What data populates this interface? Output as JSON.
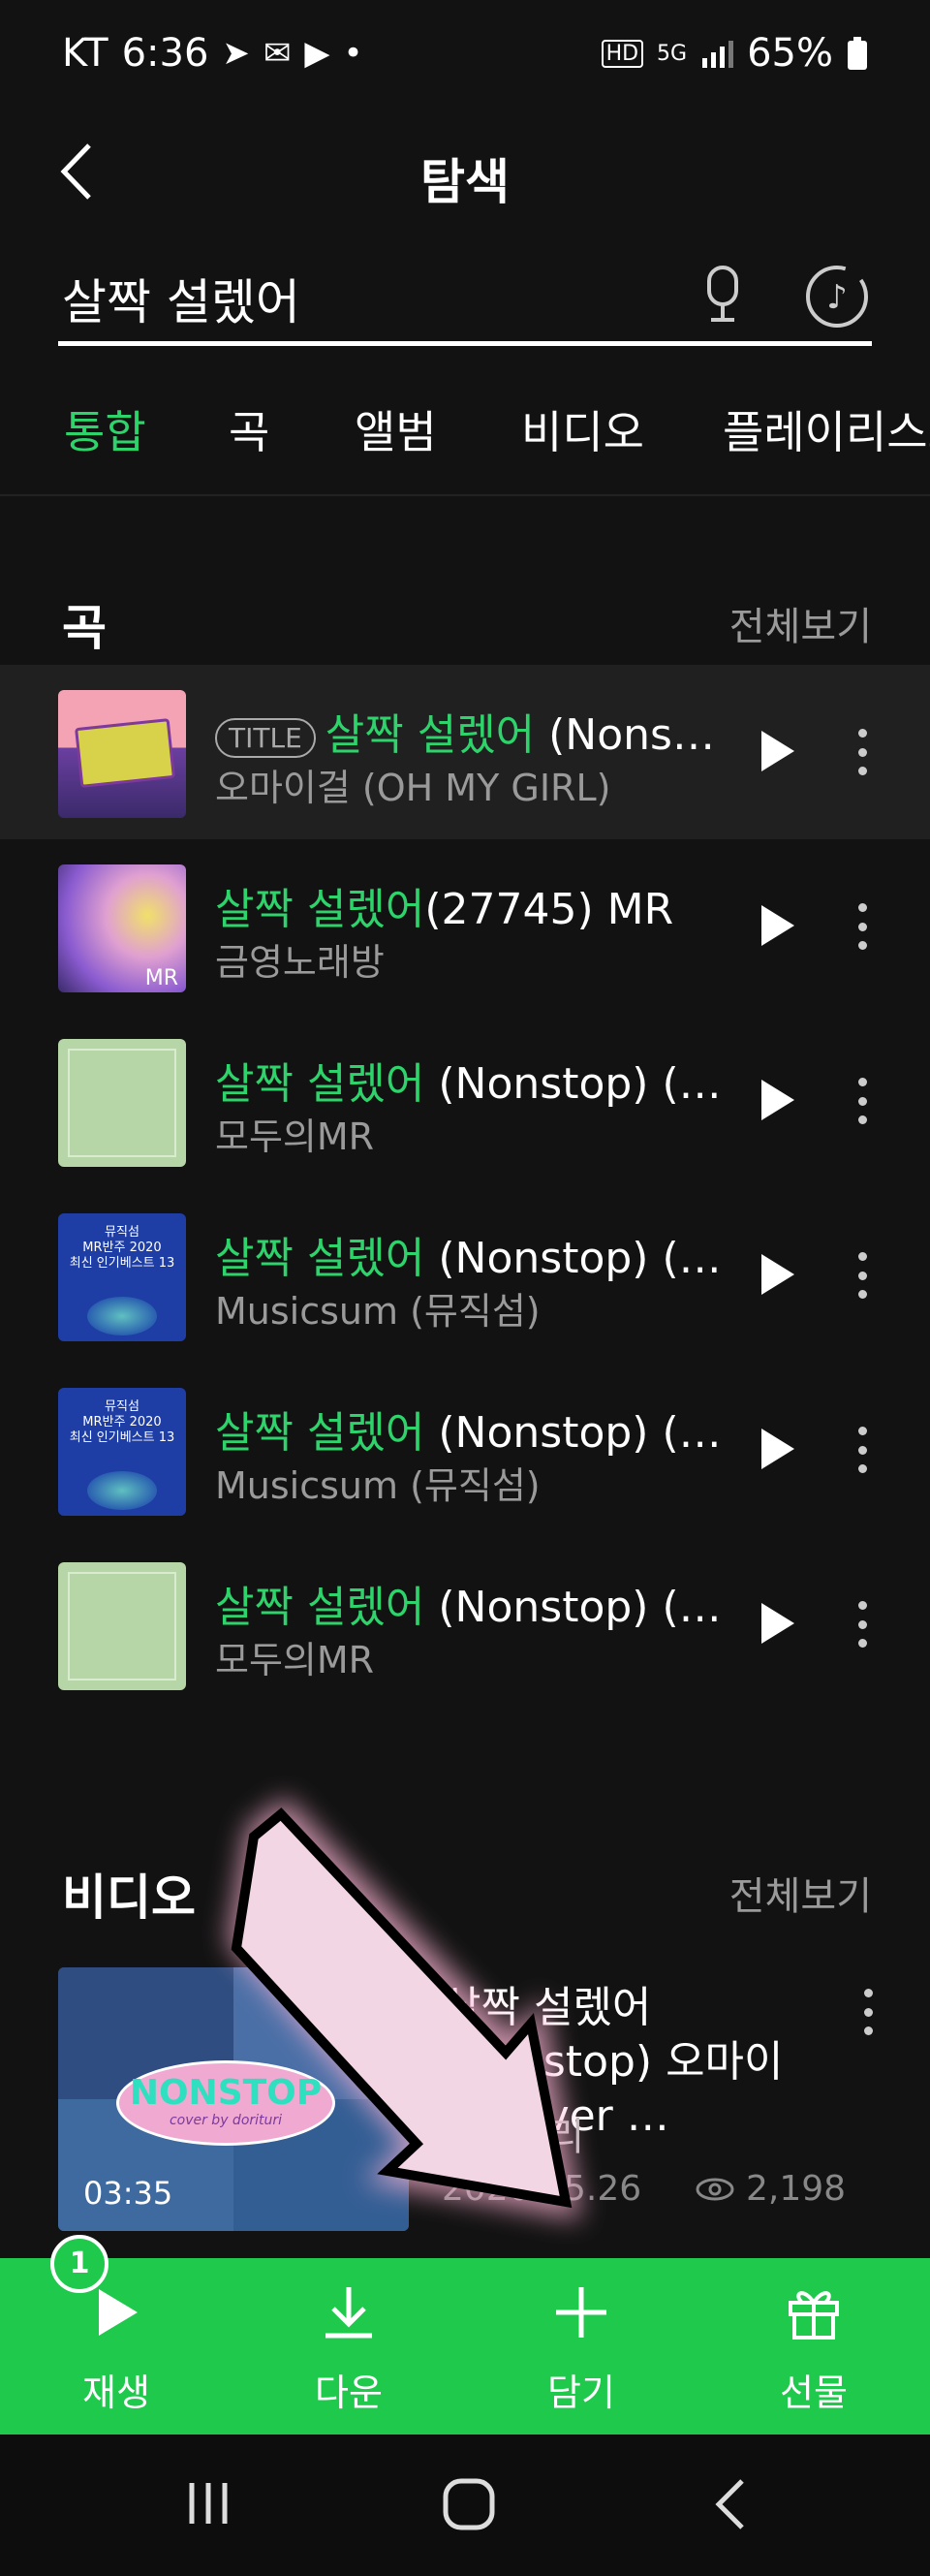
{
  "status_bar": {
    "carrier": "KT",
    "time": "6:36",
    "battery": "65%"
  },
  "header": {
    "title": "탐색"
  },
  "search": {
    "query": "살짝 설렜어"
  },
  "tabs": [
    {
      "label": "통합",
      "active": true
    },
    {
      "label": "곡",
      "active": false
    },
    {
      "label": "앨범",
      "active": false
    },
    {
      "label": "비디오",
      "active": false
    },
    {
      "label": "플레이리스트",
      "active": false
    }
  ],
  "songs_section": {
    "title": "곡",
    "more_label": "전체보기",
    "items": [
      {
        "badge": "TITLE",
        "highlight": "살짝 설렜어",
        "rest": " (Nonstop)",
        "artist": "오마이걸 (OH MY GIRL)"
      },
      {
        "badge": "",
        "highlight": "살짝 설렜어",
        "rest": "(27745) MR",
        "artist": "금영노래방"
      },
      {
        "badge": "",
        "highlight": "살짝 설렜어",
        "rest": " (Nonstop) (MR)",
        "artist": "모두의MR"
      },
      {
        "badge": "",
        "highlight": "살짝 설렜어",
        "rest": " (Nonstop) (MR)",
        "artist": "Musicsum (뮤직섬)"
      },
      {
        "badge": "",
        "highlight": "살짝 설렜어",
        "rest": " (Nonstop) (멜…",
        "artist": "Musicsum (뮤직섬)"
      },
      {
        "badge": "",
        "highlight": "살짝 설렜어",
        "rest": " (Nonstop) (Me…",
        "artist": "모두의MR"
      }
    ]
  },
  "thumbnails": {
    "mr_label": "MR",
    "musicsum_line1": "뮤직섬",
    "musicsum_line2": "MR반주 2020",
    "musicsum_line3": "최신 인기베스트 13"
  },
  "video_section": {
    "title": "비디오",
    "more_label": "전체보기",
    "item": {
      "title": "살짝 설렜어(Nonstop) 오마이걸 cover …",
      "channel": "도리투리",
      "date": "2020.05.26",
      "views": "2,198",
      "duration": "03:35",
      "thumb_text": "NONSTOP",
      "thumb_sub": "cover by dorituri"
    }
  },
  "action_bar": {
    "selected_count": "1",
    "play": "재생",
    "download": "다운",
    "add": "담기",
    "gift": "선물"
  },
  "colors": {
    "accent": "#2ed36b",
    "action_bar": "#1ec94c",
    "background": "#121212"
  }
}
